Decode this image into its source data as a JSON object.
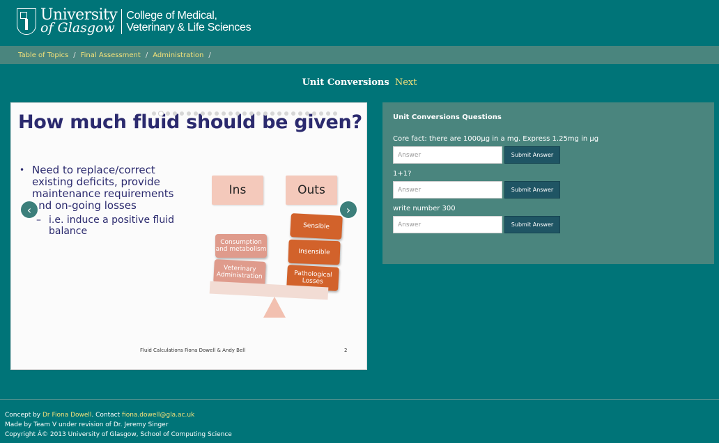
{
  "header": {
    "university_line1": "University",
    "university_line2": "of Glasgow",
    "college_line1": "College of Medical,",
    "college_line2": "Veterinary & Life Sciences"
  },
  "breadcrumb": {
    "items": [
      "Table of Topics",
      "Final Assessment",
      "Administration"
    ],
    "separator": "/"
  },
  "page": {
    "title": "Unit Conversions",
    "next_label": "Next"
  },
  "slide": {
    "heading": "How much fluid should be given?",
    "bullet1": "Need to replace/correct existing deficits, provide maintenance requirements and on-going losses",
    "bullet2": "i.e. induce a positive fluid balance",
    "ins_label": "Ins",
    "outs_label": "Outs",
    "in_blocks": [
      "Consumption and metabolism",
      "Veterinary Administration"
    ],
    "out_blocks": [
      "Sensible",
      "Insensible",
      "Pathological Losses"
    ],
    "footer_text": "Fluid Calculations   Fiona Dowell & Andy Bell",
    "slide_number": "2",
    "dot_count": 27,
    "active_dot": 1
  },
  "questions": {
    "heading": "Unit Conversions Questions",
    "items": [
      {
        "label": "Core fact: there are 1000µg in a mg. Express 1.25mg in µg",
        "placeholder": "Answer",
        "button": "Submit Answer"
      },
      {
        "label": "1+1?",
        "placeholder": "Answer",
        "button": "Submit Answer"
      },
      {
        "label": "write number 300",
        "placeholder": "Answer",
        "button": "Submit Answer"
      }
    ]
  },
  "footer": {
    "concept_prefix": "Concept by ",
    "concept_name": "Dr Fiona Dowell",
    "contact_prefix": ". Contact ",
    "contact_email": "fiona.dowell@gla.ac.uk",
    "made_by": "Made by Team V under revision of Dr. Jeremy Singer",
    "copyright": "Copyright Â© 2013 University of Glasgow, School of Computing Science"
  }
}
